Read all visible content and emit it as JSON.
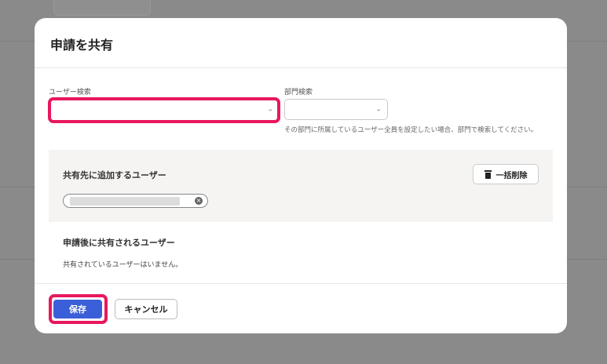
{
  "dialog": {
    "title": "申請を共有",
    "user_search": {
      "label": "ユーザー検索",
      "value": ""
    },
    "dept_search": {
      "label": "部門検索",
      "value": "",
      "hint": "その部門に所属しているユーザー全員を設定したい場合、部門で検索してください。"
    },
    "add_section": {
      "title": "共有先に追加するユーザー",
      "bulk_delete_label": "一括削除"
    },
    "shared_section": {
      "title": "申請後に共有されるユーザー",
      "empty_text": "共有されているユーザーはいません。"
    },
    "footer": {
      "save_label": "保存",
      "cancel_label": "キャンセル"
    },
    "colors": {
      "primary": "#3b5fd9",
      "highlight": "#e8175d"
    }
  }
}
